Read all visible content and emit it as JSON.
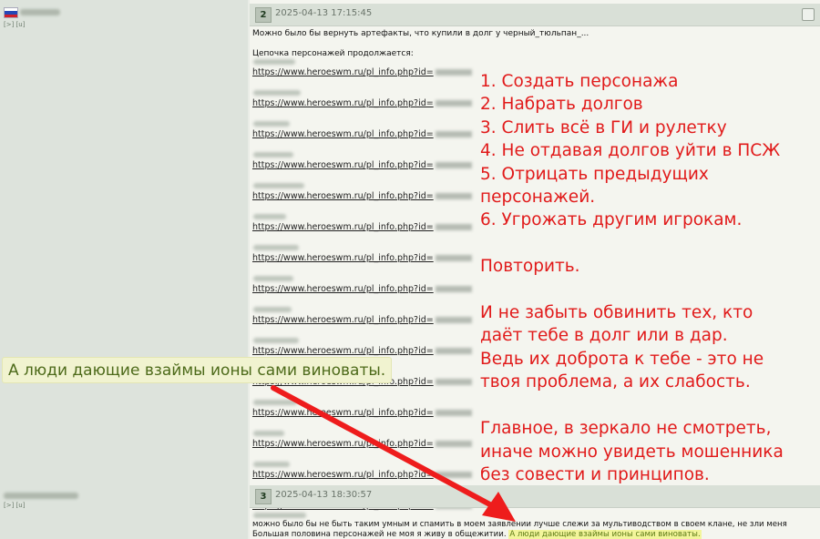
{
  "post1": {
    "number": "2",
    "date": "2025-04-13 17:15:45",
    "user_links": "[>] [u]",
    "intro": "Можно было бы вернуть артефакты, что купили в долг у черный_тюльпан_...",
    "chain": "Цепочка персонажей продолжается:",
    "links": [
      "https://www.heroeswm.ru/pl_info.php?id=",
      "https://www.heroeswm.ru/pl_info.php?id=",
      "https://www.heroeswm.ru/pl_info.php?id=",
      "https://www.heroeswm.ru/pl_info.php?id=",
      "https://www.heroeswm.ru/pl_info.php?id=",
      "https://www.heroeswm.ru/pl_info.php?id=",
      "https://www.heroeswm.ru/pl_info.php?id=",
      "https://www.heroeswm.ru/pl_info.php?id=",
      "https://www.heroeswm.ru/pl_info.php?id=",
      "https://www.heroeswm.ru/pl_info.php?id=",
      "https://www.heroeswm.ru/pl_info.php?id=",
      "https://www.heroeswm.ru/pl_info.php?id=",
      "https://www.heroeswm.ru/pl_info.php?id=",
      "https://www.heroeswm.ru/pl_info.php?id=",
      "https://www.heroeswm.ru/pl_info.php?id="
    ]
  },
  "overlay": {
    "lines": [
      "1. Создать персонажа",
      "2. Набрать долгов",
      "3. Слить всё в ГИ и рулетку",
      "4. Не отдавая долгов уйти в ПСЖ",
      "5. Отрицать предыдущих",
      "персонажей.",
      "6. Угрожать другим игрокам.",
      "",
      "Повторить.",
      "",
      "И не забыть обвинить тех, кто",
      "даёт тебе в долг или в дар.",
      "Ведь их доброта к тебе - это не",
      "твоя проблема, а их слабость.",
      "",
      "Главное, в зеркало не смотреть,",
      "иначе можно увидеть мошенника",
      "без совести и принципов."
    ],
    "quote": "А люди дающие взаймы ионы сами виноваты."
  },
  "post2": {
    "number": "3",
    "date": "2025-04-13 18:30:57",
    "user_links": "[>] [u]",
    "line1": "можно было бы не быть таким умным и спамить в моем заявлении лучше слежи за мультиводством в своем клане, не зли меня",
    "line2": "Большая половина персонажей не моя я живу в общежитии.",
    "highlight": "А люди дающие взаймы ионы сами виноваты."
  },
  "colors": {
    "overlay_red": "#e11a1a",
    "highlight_yellow": "#f2f59b",
    "arrow_red": "#ee1c1c"
  }
}
